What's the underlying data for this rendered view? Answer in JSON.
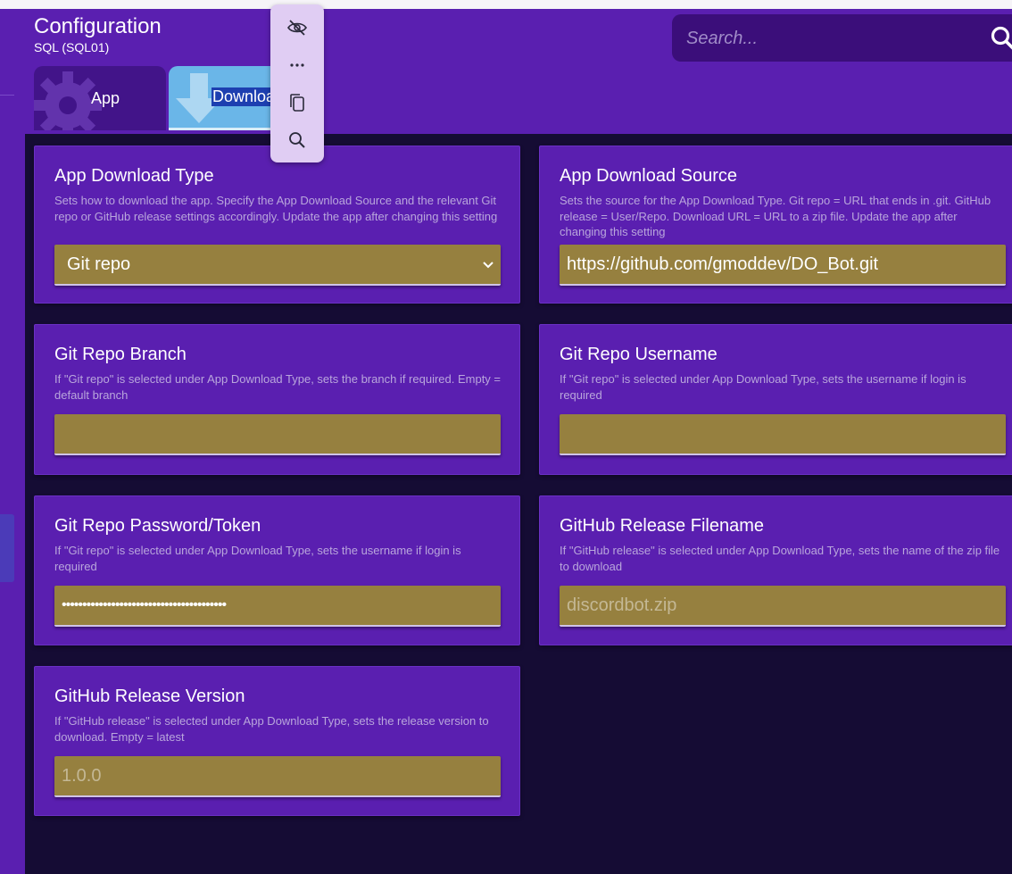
{
  "header": {
    "title": "Configuration",
    "subtitle": "SQL (SQL01)",
    "search_placeholder": "Search..."
  },
  "tabs": [
    {
      "label": "App",
      "selected": false
    },
    {
      "label": "Download",
      "selected": true
    }
  ],
  "colors": {
    "background": "#5a1fb0",
    "panel": "#150c34",
    "field": "#96803f",
    "tab_selected": "#6ab6e8"
  },
  "settings": [
    {
      "title": "App Download Type",
      "description": "Sets how to download the app. Specify the App Download Source and the relevant Git repo or GitHub release settings accordingly. Update the app after changing this setting",
      "type": "select",
      "value": "Git repo",
      "options": [
        "Git repo"
      ]
    },
    {
      "title": "App Download Source",
      "description": "Sets the source for the App Download Type. Git repo = URL that ends in .git. GitHub release = User/Repo. Download URL = URL to a zip file. Update the app after changing this setting",
      "type": "text",
      "value": "https://github.com/gmoddev/DO_Bot.git",
      "placeholder": ""
    },
    {
      "title": "Git Repo Branch",
      "description": "If \"Git repo\" is selected under App Download Type, sets the branch if required. Empty = default branch",
      "type": "text",
      "value": "",
      "placeholder": ""
    },
    {
      "title": "Git Repo Username",
      "description": "If \"Git repo\" is selected under App Download Type, sets the username if login is required",
      "type": "text",
      "value": "",
      "placeholder": ""
    },
    {
      "title": "Git Repo Password/Token",
      "description": "If \"Git repo\" is selected under App Download Type, sets the username if login is required",
      "type": "password",
      "value": "••••••••••••••••••••••••••••••••••••••••",
      "placeholder": ""
    },
    {
      "title": "GitHub Release Filename",
      "description": "If \"GitHub release\" is selected under App Download Type, sets the name of the zip file to download",
      "type": "text",
      "value": "",
      "placeholder": "discordbot.zip"
    },
    {
      "title": "GitHub Release Version",
      "description": "If \"GitHub release\" is selected under App Download Type, sets the release version to download. Empty = latest",
      "type": "text",
      "value": "",
      "placeholder": "1.0.0"
    }
  ],
  "popup_menu": {
    "icons": [
      "eye-off-icon",
      "more-icon",
      "copy-icon",
      "search-icon"
    ]
  }
}
